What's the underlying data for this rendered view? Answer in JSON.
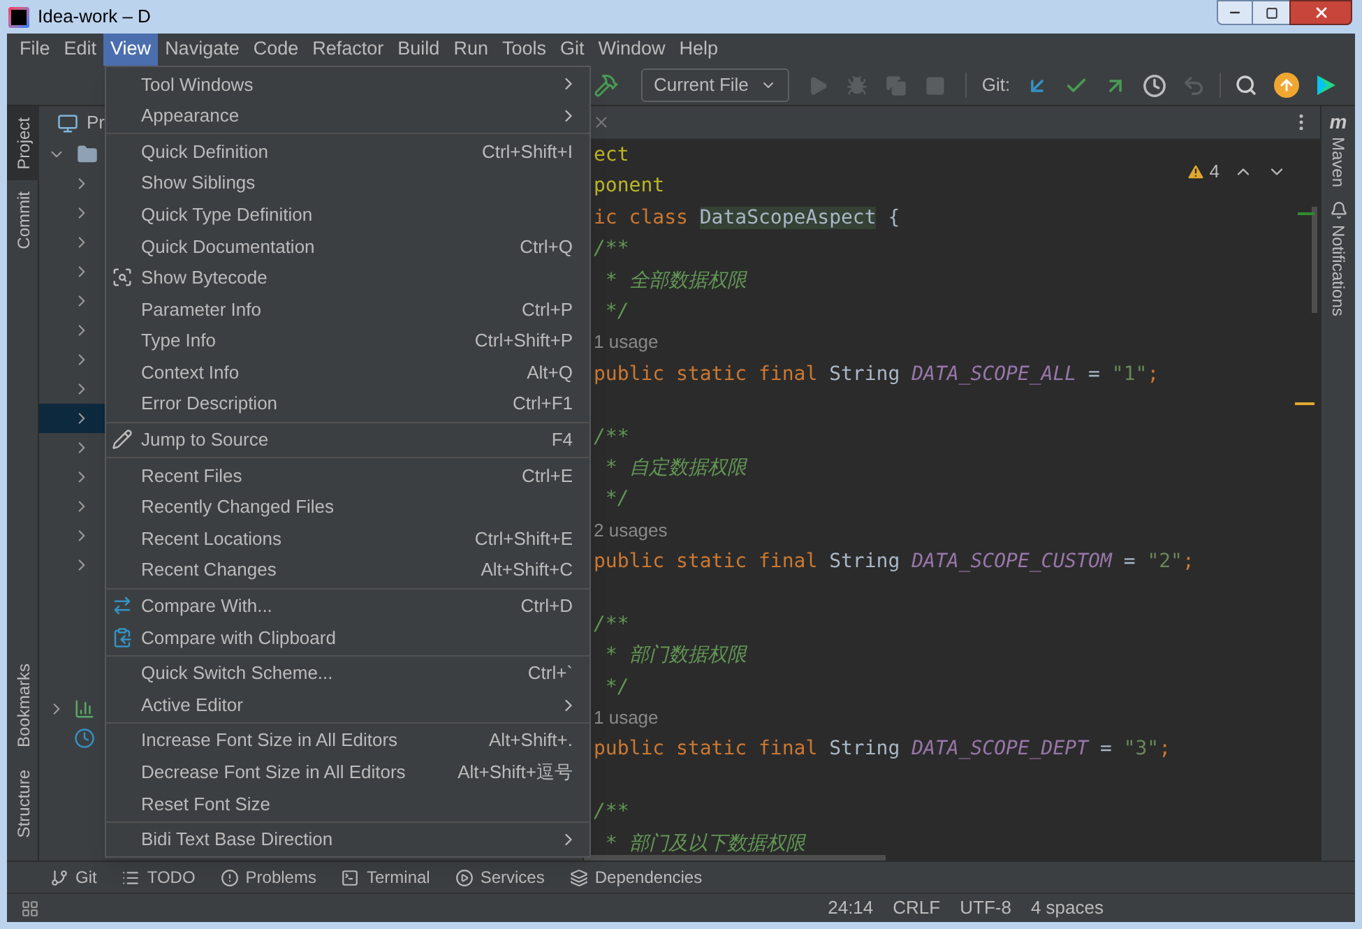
{
  "title_bar": {
    "title": "Idea-work – D"
  },
  "menu_bar": [
    {
      "label": "File",
      "selected": false
    },
    {
      "label": "Edit",
      "selected": false
    },
    {
      "label": "View",
      "selected": true
    },
    {
      "label": "Navigate",
      "selected": false
    },
    {
      "label": "Code",
      "selected": false
    },
    {
      "label": "Refactor",
      "selected": false
    },
    {
      "label": "Build",
      "selected": false
    },
    {
      "label": "Run",
      "selected": false
    },
    {
      "label": "Tools",
      "selected": false
    },
    {
      "label": "Git",
      "selected": false
    },
    {
      "label": "Window",
      "selected": false
    },
    {
      "label": "Help",
      "selected": false
    }
  ],
  "toolbar": {
    "run_config": "Current File",
    "run_actions": [
      {
        "disabled": true
      },
      {
        "disabled": true
      },
      {
        "disabled": true
      },
      {
        "disabled": true
      }
    ],
    "git_label": "Git:",
    "git_actions": [
      {
        "disabled": false
      },
      {
        "disabled": false
      },
      {
        "disabled": false
      },
      {
        "disabled": false
      },
      {
        "disabled": true
      }
    ]
  },
  "left_strip": {
    "top": [
      {
        "label": "Project",
        "selected": true
      },
      {
        "label": "Commit",
        "selected": false
      }
    ],
    "bottom": [
      {
        "label": "Bookmarks",
        "selected": false
      },
      {
        "label": "Structure",
        "selected": false
      }
    ]
  },
  "project_panel": {
    "title": "Pr",
    "rows": [
      {
        "expanded": true,
        "selected": false
      },
      {
        "expanded": false,
        "selected": false
      },
      {
        "expanded": false,
        "selected": false
      },
      {
        "expanded": false,
        "selected": false
      },
      {
        "expanded": false,
        "selected": false
      },
      {
        "expanded": false,
        "selected": false
      },
      {
        "expanded": false,
        "selected": false
      },
      {
        "expanded": false,
        "selected": false
      },
      {
        "expanded": false,
        "selected": false
      },
      {
        "expanded": false,
        "selected": true
      },
      {
        "expanded": false,
        "selected": false
      },
      {
        "expanded": false,
        "selected": false
      },
      {
        "expanded": false,
        "selected": false
      },
      {
        "expanded": false,
        "selected": false
      },
      {
        "expanded": false,
        "selected": false
      }
    ]
  },
  "view_menu": [
    [
      {
        "label": "Tool Windows",
        "submenu": true
      },
      {
        "label": "Appearance",
        "submenu": true
      }
    ],
    [
      {
        "label": "Quick Definition",
        "shortcut": "Ctrl+Shift+I",
        "submenu": false
      },
      {
        "label": "Show Siblings",
        "submenu": false
      },
      {
        "label": "Quick Type Definition",
        "submenu": false
      },
      {
        "label": "Quick Documentation",
        "shortcut": "Ctrl+Q",
        "submenu": false
      },
      {
        "label": "Show Bytecode",
        "submenu": false
      },
      {
        "label": "Parameter Info",
        "shortcut": "Ctrl+P",
        "submenu": false
      },
      {
        "label": "Type Info",
        "shortcut": "Ctrl+Shift+P",
        "submenu": false
      },
      {
        "label": "Context Info",
        "shortcut": "Alt+Q",
        "submenu": false
      },
      {
        "label": "Error Description",
        "shortcut": "Ctrl+F1",
        "submenu": false
      }
    ],
    [
      {
        "label": "Jump to Source",
        "shortcut": "F4",
        "submenu": false
      }
    ],
    [
      {
        "label": "Recent Files",
        "shortcut": "Ctrl+E",
        "submenu": false
      },
      {
        "label": "Recently Changed Files",
        "submenu": false
      },
      {
        "label": "Recent Locations",
        "shortcut": "Ctrl+Shift+E",
        "submenu": false
      },
      {
        "label": "Recent Changes",
        "shortcut": "Alt+Shift+C",
        "submenu": false
      }
    ],
    [
      {
        "label": "Compare With...",
        "shortcut": "Ctrl+D",
        "submenu": false
      },
      {
        "label": "Compare with Clipboard",
        "submenu": false
      }
    ],
    [
      {
        "label": "Quick Switch Scheme...",
        "shortcut": "Ctrl+`",
        "submenu": false
      },
      {
        "label": "Active Editor",
        "submenu": true
      }
    ],
    [
      {
        "label": "Increase Font Size in All Editors",
        "shortcut": "Alt+Shift+.",
        "submenu": false
      },
      {
        "label": "Decrease Font Size in All Editors",
        "shortcut": "Alt+Shift+逗号",
        "submenu": false
      },
      {
        "label": "Reset Font Size",
        "submenu": false
      }
    ],
    [
      {
        "label": "Bidi Text Base Direction",
        "submenu": true
      }
    ]
  ],
  "editor": {
    "warning_count": "4",
    "blocks": [
      [
        [
          {
            "text": "ect",
            "kind": "annotation"
          }
        ],
        [
          {
            "text": "ponent",
            "kind": "annotation"
          }
        ],
        [
          {
            "text": "ic class ",
            "kind": "keyword"
          },
          {
            "text": "DataScopeAspect",
            "kind": "declaration"
          },
          {
            "text": " {",
            "kind": "plain"
          }
        ],
        [
          {
            "text": "/**",
            "kind": "comment"
          }
        ],
        [
          {
            "text": " * 全部数据权限",
            "kind": "comment"
          }
        ],
        [
          {
            "text": " */",
            "kind": "comment"
          }
        ],
        [
          {
            "text": "1 usage",
            "kind": "usage"
          }
        ],
        [
          {
            "text": "public static final ",
            "kind": "keyword"
          },
          {
            "text": "String ",
            "kind": "plain"
          },
          {
            "text": "DATA_SCOPE_ALL",
            "kind": "constant"
          },
          {
            "text": " = ",
            "kind": "plain"
          },
          {
            "text": "\"1\"",
            "kind": "string"
          },
          {
            "text": ";",
            "kind": "keyword"
          }
        ]
      ],
      [
        [
          {
            "text": "/**",
            "kind": "comment"
          }
        ],
        [
          {
            "text": " * 自定数据权限",
            "kind": "comment"
          }
        ],
        [
          {
            "text": " */",
            "kind": "comment"
          }
        ],
        [
          {
            "text": "2 usages",
            "kind": "usage"
          }
        ],
        [
          {
            "text": "public static final ",
            "kind": "keyword"
          },
          {
            "text": "String ",
            "kind": "plain"
          },
          {
            "text": "DATA_SCOPE_CUSTOM",
            "kind": "constant"
          },
          {
            "text": " = ",
            "kind": "plain"
          },
          {
            "text": "\"2\"",
            "kind": "string"
          },
          {
            "text": ";",
            "kind": "keyword"
          }
        ]
      ],
      [
        [
          {
            "text": "/**",
            "kind": "comment"
          }
        ],
        [
          {
            "text": " * 部门数据权限",
            "kind": "comment"
          }
        ],
        [
          {
            "text": " */",
            "kind": "comment"
          }
        ],
        [
          {
            "text": "1 usage",
            "kind": "usage"
          }
        ],
        [
          {
            "text": "public static final ",
            "kind": "keyword"
          },
          {
            "text": "String ",
            "kind": "plain"
          },
          {
            "text": "DATA_SCOPE_DEPT",
            "kind": "constant"
          },
          {
            "text": " = ",
            "kind": "plain"
          },
          {
            "text": "\"3\"",
            "kind": "string"
          },
          {
            "text": ";",
            "kind": "keyword"
          }
        ]
      ],
      [
        [
          {
            "text": "/**",
            "kind": "comment"
          }
        ],
        [
          {
            "text": " * 部门及以下数据权限",
            "kind": "comment"
          }
        ]
      ]
    ]
  },
  "right_strip": [
    {
      "icon_text": "m",
      "label": "Maven"
    },
    {
      "label": "Notifications"
    }
  ],
  "tool_windows": [
    "Git",
    "TODO",
    "Problems",
    "Terminal",
    "Services",
    "Dependencies"
  ],
  "status_bar": [
    "24:14",
    "CRLF",
    "UTF-8",
    "4 spaces"
  ]
}
